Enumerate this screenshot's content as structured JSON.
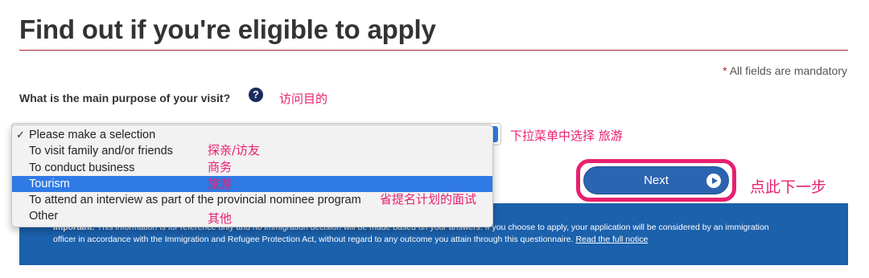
{
  "page": {
    "title": "Find out if you're eligible to apply",
    "mandatory_star": "*",
    "mandatory_text": " All fields are mandatory"
  },
  "question": {
    "label": "What is the main purpose of your visit?",
    "help_icon": "?"
  },
  "dropdown": {
    "options": [
      {
        "label": "Please make a selection",
        "checked": true,
        "highlighted": false
      },
      {
        "label": "To visit family and/or friends",
        "checked": false,
        "highlighted": false
      },
      {
        "label": "To conduct business",
        "checked": false,
        "highlighted": false
      },
      {
        "label": "Tourism",
        "checked": false,
        "highlighted": true
      },
      {
        "label": "To attend an interview as part of the provincial nominee program",
        "checked": false,
        "highlighted": false
      },
      {
        "label": "Other",
        "checked": false,
        "highlighted": false
      }
    ],
    "checkmark": "✓"
  },
  "next_button": {
    "label": "Next",
    "icon": "play-circle-icon"
  },
  "annotations": {
    "question": "访问目的",
    "pick": "下拉菜单中选择  旅游",
    "next": "点此下一步",
    "family": "探亲/访友",
    "business": "商务",
    "tourism": "旅游",
    "interview": "省提名计划的面试",
    "other": "其他"
  },
  "banner": {
    "important_label": "Important:",
    "line1_text": " This information is for reference only and no immigration decision will be made based on your answers. If you choose to apply, your application will be considered by an immigration",
    "line2_text": "officer in accordance with the Immigration and Refugee Protection Act, without regard to any outcome you attain through this questionnaire. ",
    "link": "Read the full notice"
  },
  "colors": {
    "accent_red": "#a8272b",
    "annotation_pink": "#e8206f",
    "button_blue": "#2b64b0",
    "banner_blue": "#1b61ac",
    "highlight_blue": "#2f7ae5"
  }
}
